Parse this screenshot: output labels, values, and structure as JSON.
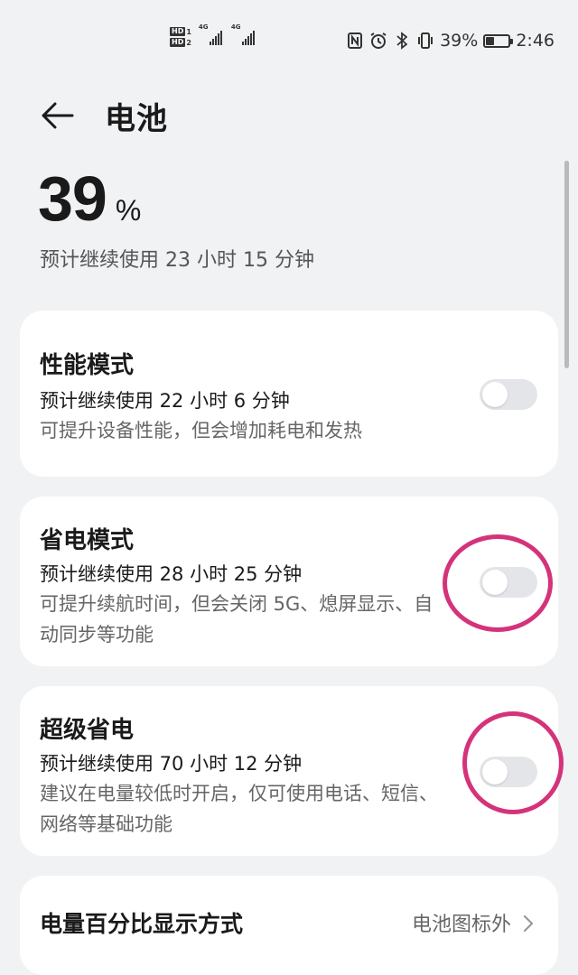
{
  "status_bar": {
    "sim1": "HD",
    "sim1_num": "1",
    "sim2": "HD",
    "sim2_num": "2",
    "net1": "4G",
    "net2": "4G",
    "battery_pct": "39%",
    "battery_level": 0.39,
    "time": "2:46",
    "icons": [
      "nfc-icon",
      "alarm-icon",
      "bluetooth-icon",
      "vibrate-icon"
    ]
  },
  "header": {
    "title": "电池"
  },
  "battery": {
    "level": "39",
    "unit": "%",
    "remaining": "预计继续使用 23 小时 15 分钟"
  },
  "modes": [
    {
      "title": "性能模式",
      "estimate": "预计继续使用 22 小时 6 分钟",
      "description": "可提升设备性能，但会增加耗电和发热",
      "enabled": false
    },
    {
      "title": "省电模式",
      "estimate": "预计继续使用 28 小时 25 分钟",
      "description": "可提升续航时间，但会关闭 5G、熄屏显示、自动同步等功能",
      "enabled": false
    },
    {
      "title": "超级省电",
      "estimate": "预计继续使用 70 小时 12 分钟",
      "description": "建议在电量较低时开启，仅可使用电话、短信、网络等基础功能",
      "enabled": false
    }
  ],
  "percent_display": {
    "label": "电量百分比显示方式",
    "value": "电池图标外"
  },
  "colors": {
    "background": "#f1f2f4",
    "card": "#ffffff",
    "toggle_off": "#e4e5e8",
    "annotation_ring": "#d4337a"
  }
}
